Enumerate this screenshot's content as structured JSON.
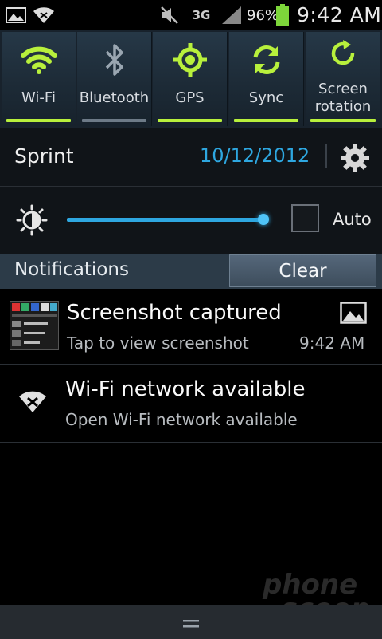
{
  "status_bar": {
    "network_type": "3G",
    "battery_percent": "96%",
    "time": "9:42 AM",
    "icons": [
      "picture-icon",
      "wifi-icon",
      "mute-icon",
      "signal-icon",
      "battery-icon"
    ]
  },
  "toggles": [
    {
      "label": "Wi-Fi",
      "icon": "wifi-icon",
      "state": "on"
    },
    {
      "label": "Bluetooth",
      "icon": "bluetooth-icon",
      "state": "off"
    },
    {
      "label": "GPS",
      "icon": "gps-icon",
      "state": "on"
    },
    {
      "label": "Sync",
      "icon": "sync-icon",
      "state": "on"
    },
    {
      "label": "Screen rotation",
      "label_line1": "Screen",
      "label_line2": "rotation",
      "icon": "rotation-icon",
      "state": "on"
    }
  ],
  "info": {
    "carrier": "Sprint",
    "date": "10/12/2012"
  },
  "brightness": {
    "level": 0.97,
    "auto_label": "Auto",
    "auto_checked": false
  },
  "notifications": {
    "header": "Notifications",
    "clear_label": "Clear",
    "items": [
      {
        "title": "Screenshot captured",
        "subtitle": "Tap to view screenshot",
        "time": "9:42 AM",
        "icon": "screenshot-thumbnail",
        "badge_icon": "picture-icon"
      },
      {
        "title": "Wi-Fi network available",
        "subtitle": "Open Wi-Fi network available",
        "icon": "wifi-icon"
      }
    ]
  },
  "watermark": "Phone Scoop",
  "colors": {
    "accent_green": "#b8f03c",
    "accent_blue": "#2ea7e0",
    "toggle_bg": "#1d2b37"
  }
}
